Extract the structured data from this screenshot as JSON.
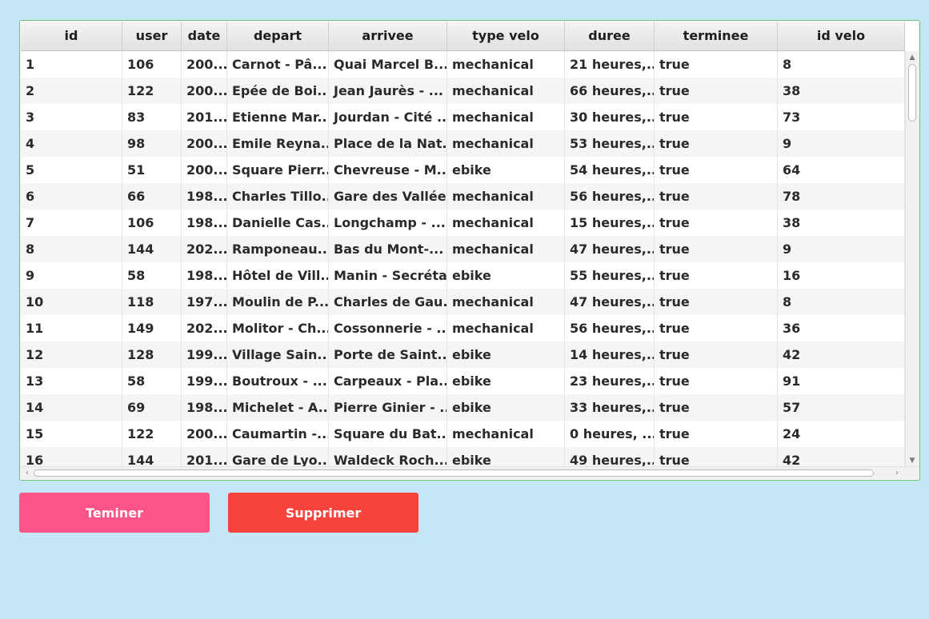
{
  "table": {
    "columns": [
      "id",
      "user",
      "date",
      "depart",
      "arrivee",
      "type velo",
      "duree",
      "terminee",
      "id velo"
    ],
    "rows": [
      [
        "1",
        "106",
        "200...",
        "Carnot - Pâ...",
        "Quai Marcel B...",
        "mechanical",
        "21 heures,...",
        "true",
        "8"
      ],
      [
        "2",
        "122",
        "200...",
        "Epée de Boi...",
        "Jean Jaurès - ...",
        "mechanical",
        "66 heures,...",
        "true",
        "38"
      ],
      [
        "3",
        "83",
        "201...",
        "Etienne Mar...",
        "Jourdan - Cité ...",
        "mechanical",
        "30 heures,...",
        "true",
        "73"
      ],
      [
        "4",
        "98",
        "200...",
        "Emile Reyna...",
        "Place de la Nat...",
        "mechanical",
        "53 heures,...",
        "true",
        "9"
      ],
      [
        "5",
        "51",
        "200...",
        "Square Pierr...",
        "Chevreuse - M...",
        "ebike",
        "54 heures,...",
        "true",
        "64"
      ],
      [
        "6",
        "66",
        "198...",
        "Charles Tillo...",
        "Gare des Vallées",
        "mechanical",
        "56 heures,...",
        "true",
        "78"
      ],
      [
        "7",
        "106",
        "198...",
        "Danielle Cas...",
        "Longchamp - ...",
        "mechanical",
        "15 heures,...",
        "true",
        "38"
      ],
      [
        "8",
        "144",
        "202...",
        "Ramponeau...",
        "Bas du Mont-...",
        "mechanical",
        "47 heures,...",
        "true",
        "9"
      ],
      [
        "9",
        "58",
        "198...",
        "Hôtel de Vill...",
        "Manin - Secrétan",
        "ebike",
        "55 heures,...",
        "true",
        "16"
      ],
      [
        "10",
        "118",
        "197...",
        "Moulin de P...",
        "Charles de Gau...",
        "mechanical",
        "47 heures,...",
        "true",
        "8"
      ],
      [
        "11",
        "149",
        "202...",
        "Molitor - Ch...",
        "Cossonnerie - ...",
        "mechanical",
        "56 heures,...",
        "true",
        "36"
      ],
      [
        "12",
        "128",
        "199...",
        "Village Sain...",
        "Porte de Saint...",
        "ebike",
        "14 heures,...",
        "true",
        "42"
      ],
      [
        "13",
        "58",
        "199...",
        "Boutroux - ...",
        "Carpeaux - Pla...",
        "ebike",
        "23 heures,...",
        "true",
        "91"
      ],
      [
        "14",
        "69",
        "198...",
        "Michelet - A...",
        "Pierre Ginier - ...",
        "ebike",
        "33 heures,...",
        "true",
        "57"
      ],
      [
        "15",
        "122",
        "200...",
        "Caumartin -...",
        "Square du Bat...",
        "mechanical",
        "0 heures, ...",
        "true",
        "24"
      ],
      [
        "16",
        "144",
        "201...",
        "Gare de Lyo...",
        "Waldeck Roch...",
        "ebike",
        "49 heures,...",
        "true",
        "42"
      ]
    ]
  },
  "buttons": {
    "finish_label": "Teminer",
    "delete_label": "Supprimer"
  },
  "icons": {
    "scroll_up": "chevron-up-icon",
    "scroll_down": "chevron-down-icon",
    "scroll_left": "chevron-left-icon",
    "scroll_right": "chevron-right-icon"
  },
  "colors": {
    "background": "#c6e6f5",
    "table_border": "#6bc46b",
    "finish_button": "#fb5587",
    "delete_button": "#f6433c"
  }
}
